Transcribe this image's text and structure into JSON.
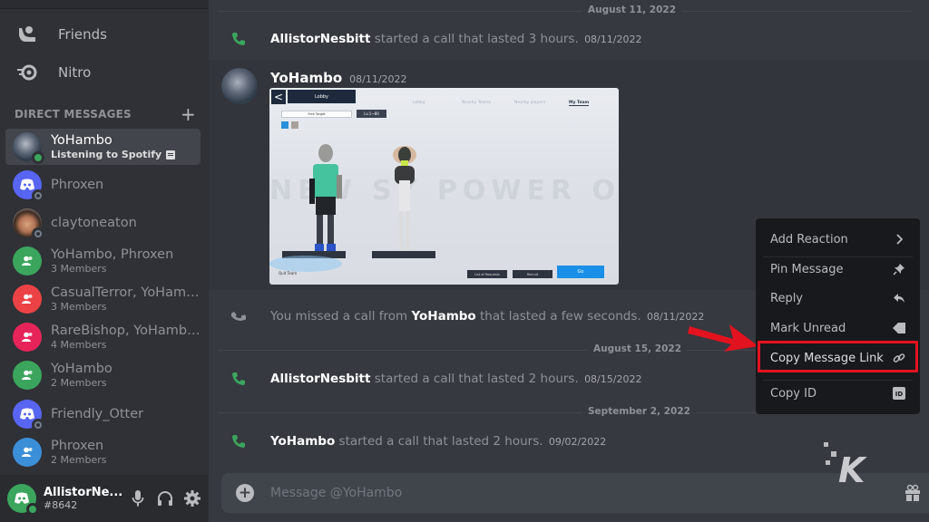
{
  "sidebar": {
    "nav": [
      {
        "label": "Friends",
        "icon": "friends-icon"
      },
      {
        "label": "Nitro",
        "icon": "nitro-icon"
      }
    ],
    "dm_header": "DIRECT MESSAGES",
    "dm_add_icon": "plus-icon",
    "dms": [
      {
        "name": "YoHambo",
        "sub": "Listening to Spotify",
        "avatar": "user-avatar",
        "status": "online",
        "active": true
      },
      {
        "name": "Phroxen",
        "sub": "",
        "avatar": "discord-default-avatar",
        "color": "#5865f2",
        "status": "offline"
      },
      {
        "name": "claytoneaton",
        "sub": "",
        "avatar": "photo-avatar",
        "status": "offline"
      },
      {
        "name": "YoHambo, Phroxen",
        "sub": "3 Members",
        "avatar": "group-icon",
        "color": "#3ba55d"
      },
      {
        "name": "CasualTerror, YoHambo",
        "sub": "3 Members",
        "avatar": "group-icon",
        "color": "#ed4245"
      },
      {
        "name": "RareBishop, YoHambo...",
        "sub": "4 Members",
        "avatar": "group-icon",
        "color": "#eb459e"
      },
      {
        "name": "YoHambo",
        "sub": "2 Members",
        "avatar": "group-icon",
        "color": "#3ba55d"
      },
      {
        "name": "Friendly_Otter",
        "sub": "",
        "avatar": "discord-default-avatar",
        "color": "#5865f2",
        "status": "offline"
      },
      {
        "name": "Phroxen",
        "sub": "2 Members",
        "avatar": "group-icon",
        "color": "#3b8fd8"
      }
    ],
    "user_panel": {
      "name": "AllistorNe...",
      "tag": "#8642",
      "controls": [
        "microphone-icon",
        "headphones-icon",
        "settings-gear-icon"
      ]
    }
  },
  "chat": {
    "dividers": {
      "aug11": "August 11, 2022",
      "aug15": "August 15, 2022",
      "sep2": "September 2, 2022"
    },
    "messages": [
      {
        "type": "call",
        "author": "AllistorNesbitt",
        "text": "started a call that lasted 3 hours.",
        "timestamp": "08/11/2022",
        "icon": "phone-icon"
      },
      {
        "type": "message",
        "author": "YoHambo",
        "timestamp": "08/11/2022",
        "attachment": {
          "kind": "game-screenshot",
          "back": "<",
          "title": "Lobby",
          "tabs": [
            "Lobby",
            "Nearby Teams",
            "Nearby players",
            "My Team"
          ],
          "target": "Free Target",
          "level": "Lv.1~80",
          "banner": "NEW SY POWER OF FA",
          "go": "Go",
          "buttons": [
            "List of Requests",
            "Recruit"
          ],
          "quit": "Quit Team"
        }
      },
      {
        "type": "missed-call",
        "prefix": "You missed a call from",
        "author": "YoHambo",
        "text": "that lasted a few seconds.",
        "timestamp": "08/11/2022",
        "icon": "missed-call-icon"
      },
      {
        "type": "call",
        "author": "AllistorNesbitt",
        "text": "started a call that lasted 2 hours.",
        "timestamp": "08/15/2022",
        "icon": "phone-icon"
      },
      {
        "type": "call",
        "author": "YoHambo",
        "text": "started a call that lasted 2 hours.",
        "timestamp": "09/02/2022",
        "icon": "phone-icon"
      }
    ],
    "composer": {
      "placeholder": "Message @YoHambo",
      "value": ""
    }
  },
  "context_menu": {
    "items": [
      {
        "label": "Add Reaction",
        "icon": "chevron-right-icon"
      },
      {
        "label": "Pin Message",
        "icon": "pin-icon"
      },
      {
        "label": "Reply",
        "icon": "reply-icon"
      },
      {
        "label": "Mark Unread",
        "icon": "mark-unread-icon"
      },
      {
        "label": "Copy Message Link",
        "icon": "link-icon",
        "highlighted": true
      },
      {
        "label": "Copy ID",
        "icon": "id-icon"
      }
    ]
  },
  "annotation": {
    "arrow_color": "#e3121f",
    "watermark": "K"
  },
  "colors": {
    "online": "#3ba55d",
    "call_green": "#3ba55d",
    "blurple": "#5865f2"
  }
}
